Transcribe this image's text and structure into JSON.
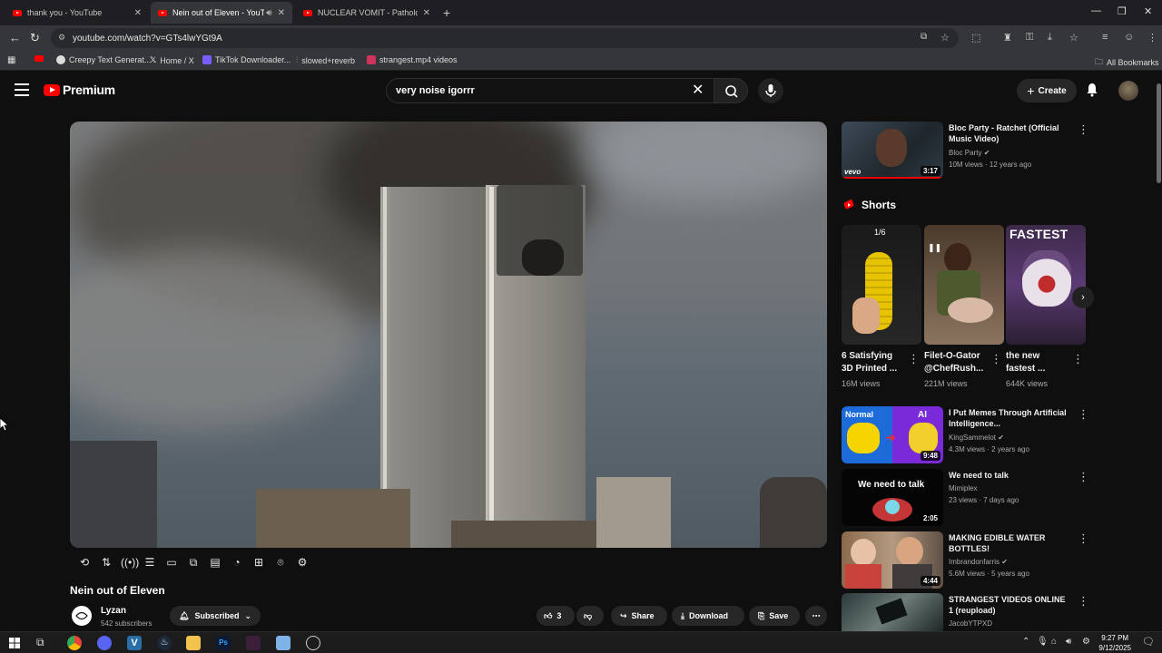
{
  "browser": {
    "tabs": [
      {
        "title": "thank you - YouTube",
        "active": false
      },
      {
        "title": "Nein out of Eleven - YouTube",
        "active": true
      },
      {
        "title": "NUCLEAR VOMIT - Pathological",
        "active": false
      }
    ],
    "url": "youtube.com/watch?v=GTs4lwYGt9A",
    "bookmarks": [
      "Creepy Text Generat...",
      "Home / X",
      "TikTok Downloader...",
      "slowed+reverb",
      "strangest.mp4 videos"
    ],
    "all_bookmarks": "All Bookmarks"
  },
  "header": {
    "logo_text": "Premium",
    "search_value": "very noise igorrr",
    "create_label": "Create"
  },
  "video": {
    "title": "Nein out of Eleven",
    "channel": "Lyzan",
    "subscribers": "542 subscribers",
    "subscribed_label": "Subscribed",
    "likes": "3",
    "share_label": "Share",
    "download_label": "Download",
    "save_label": "Save"
  },
  "sidebar": {
    "top_video": {
      "title": "Bloc Party - Ratchet (Official Music Video)",
      "channel": "Bloc Party",
      "meta": "10M views · 12 years ago",
      "duration": "3:17",
      "brand": "vevo"
    },
    "shorts_heading": "Shorts",
    "shorts": [
      {
        "title": "6 Satisfying 3D Printed ...",
        "views": "16M views",
        "badge": "1/6"
      },
      {
        "title": "Filet-O-Gator @ChefRush...",
        "views": "221M views",
        "badge": ""
      },
      {
        "title": "the new fastest ...",
        "views": "644K views",
        "badge": "FASTEST"
      }
    ],
    "videos": [
      {
        "title": "I Put Memes Through Artificial Intelligence...",
        "channel": "KingSammelot",
        "meta": "4.3M views · 2 years ago",
        "duration": "9:48",
        "thumb_left": "Normal",
        "thumb_right": "AI"
      },
      {
        "title": "We need to talk",
        "channel": "Mimiplex",
        "meta": "23 views · 7 days ago",
        "duration": "2:05",
        "thumb_text": "We need to talk"
      },
      {
        "title": "MAKING EDIBLE WATER BOTTLES!",
        "channel": "Imbrandonfarris",
        "meta": "5.6M views · 5 years ago",
        "duration": "4:44"
      },
      {
        "title": "STRANGEST VIDEOS ONLINE 1 (reupload)",
        "channel": "JacobYTPXD",
        "meta": "",
        "duration": ""
      }
    ]
  },
  "taskbar": {
    "time": "9:27 PM",
    "date": "9/12/2025"
  },
  "colors": {
    "yt_red": "#ff0000",
    "bg": "#0f0f0f",
    "chip": "#272727"
  }
}
